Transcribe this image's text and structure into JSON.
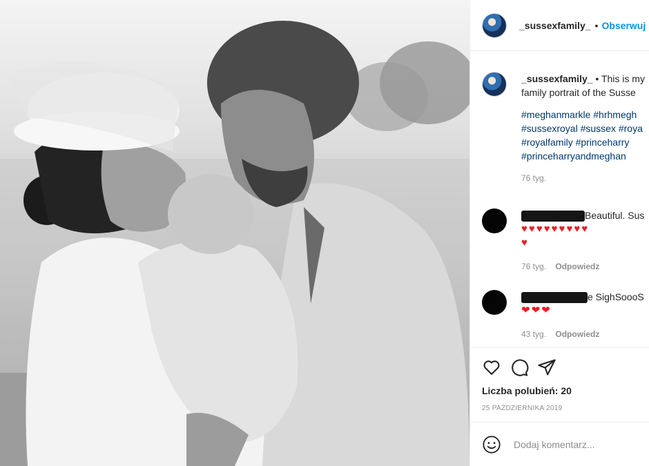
{
  "post": {
    "image_alt": "family-portrait-photo",
    "username": "_sussexfamily_",
    "separator": "•",
    "follow_label": "Obserwuj",
    "caption_username": "_sussexfamily_",
    "caption_lead": " • This is my",
    "caption_line2": "family portrait of the Susse",
    "hashtags": [
      "#meghanmarkle #hrhmegh",
      "#sussexroyal #sussex #roya",
      "#royalfamily #princeharry",
      "#princeharryandmeghan"
    ],
    "caption_time": "76 tyg."
  },
  "comments": [
    {
      "text": "Beautiful. Sus",
      "hearts": "♥♥♥♥♥♥♥♥♥",
      "hearts2": "♥",
      "time": "76 tyg.",
      "reply": "Odpowiedz"
    },
    {
      "text": "e SighSoooS",
      "hearts": "❤❤❤",
      "time": "43 tyg.",
      "reply": "Odpowiedz"
    }
  ],
  "actions": {
    "likes_label": "Liczba polubień: 20",
    "date": "25 PAŹDZIERNIKA 2019"
  },
  "add_comment": {
    "placeholder": "Dodaj komentarz..."
  },
  "icons": [
    "heart-icon",
    "comment-icon",
    "share-icon",
    "emoji-icon"
  ],
  "colors": {
    "link": "#0095f6",
    "hashtag": "#00376b",
    "muted": "#8e8e8e",
    "heart": "#ed1c24"
  }
}
